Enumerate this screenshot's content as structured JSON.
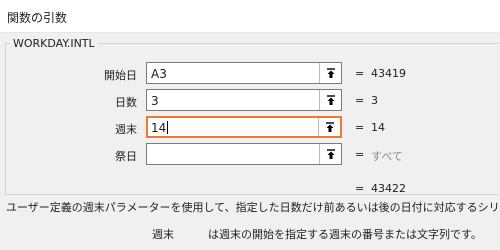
{
  "dialog": {
    "title": "関数の引数"
  },
  "function": {
    "name": "WORKDAY.INTL"
  },
  "args": [
    {
      "label": "開始日",
      "value": "A3",
      "equals": "=",
      "result": "43419"
    },
    {
      "label": "日数",
      "value": "3",
      "equals": "=",
      "result": "3"
    },
    {
      "label": "週末",
      "value": "14",
      "equals": "=",
      "result": "14"
    },
    {
      "label": "祭日",
      "value": "",
      "equals": "=",
      "result": "すべて"
    }
  ],
  "formula_result": {
    "equals": "=",
    "value": "43422"
  },
  "description": "ユーザー定義の週末パラメーターを使用して、指定した日数だけ前あるいは後の日付に対応するシリアル値",
  "arg_help": {
    "name": "週末",
    "text": "は週末の開始を指定する週末の番号または文字列です。"
  },
  "icons": {
    "ref_button": "collapse-dialog-icon"
  },
  "colors": {
    "active_border": "#ee7a2d",
    "field_border": "#7a7a7a",
    "dialog_bg": "#f0f0f0"
  }
}
